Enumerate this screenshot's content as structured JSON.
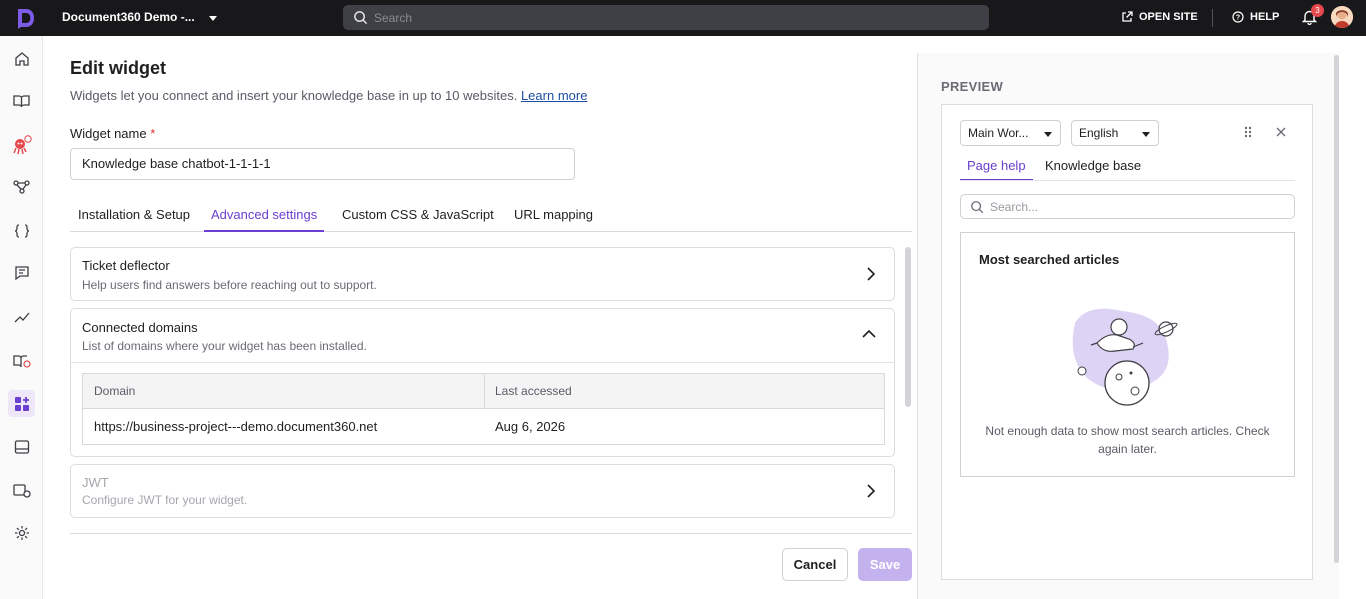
{
  "topbar": {
    "project_name": "Document360 Demo -...",
    "search_placeholder": "Search",
    "open_site_label": "OPEN SITE",
    "help_label": "HELP",
    "notification_count": "3"
  },
  "sidebar": {
    "items": [
      {
        "icon": "home-icon"
      },
      {
        "icon": "book-icon"
      },
      {
        "icon": "ai-assistant-icon"
      },
      {
        "icon": "workflow-icon"
      },
      {
        "icon": "api-braces-icon"
      },
      {
        "icon": "feedback-icon"
      },
      {
        "icon": "analytics-icon"
      },
      {
        "icon": "knowledge-base-icon"
      },
      {
        "icon": "widgets-icon",
        "active": true
      },
      {
        "icon": "drive-icon"
      },
      {
        "icon": "kb-settings-icon"
      },
      {
        "icon": "settings-icon"
      }
    ]
  },
  "page": {
    "title": "Edit widget",
    "subtitle": "Widgets let you connect and insert your knowledge base in up to 10 websites.",
    "learn_more": "Learn more",
    "widget_name_label": "Widget name",
    "required_mark": "*",
    "widget_name_value": "Knowledge base chatbot-1-1-1-1"
  },
  "tabs": [
    {
      "label": "Installation & Setup"
    },
    {
      "label": "Advanced settings",
      "active": true
    },
    {
      "label": "Custom CSS & JavaScript"
    },
    {
      "label": "URL mapping"
    }
  ],
  "sections": {
    "ticket": {
      "title": "Ticket deflector",
      "desc": "Help users find answers before reaching out to support."
    },
    "domains": {
      "title": "Connected domains",
      "desc": "List of domains where your widget has been installed.",
      "col_domain": "Domain",
      "col_last_accessed": "Last accessed",
      "rows": [
        {
          "domain": "https://business-project---demo.document360.net",
          "last_accessed": "Aug 6, 2026"
        }
      ]
    },
    "jwt": {
      "title": "JWT",
      "desc": "Configure JWT for your widget."
    }
  },
  "footer": {
    "cancel": "Cancel",
    "save": "Save"
  },
  "preview": {
    "label": "PREVIEW",
    "workspace_select": "Main Wor...",
    "language_select": "English",
    "tab_page_help": "Page help",
    "tab_knowledge_base": "Knowledge base",
    "search_placeholder": "Search...",
    "box_title": "Most searched articles",
    "empty_message": "Not enough data to show most search articles. Check again later."
  },
  "colors": {
    "accent": "#6b3fd0",
    "topbar_bg": "#18181b",
    "save_disabled": "#c4b2ef"
  }
}
